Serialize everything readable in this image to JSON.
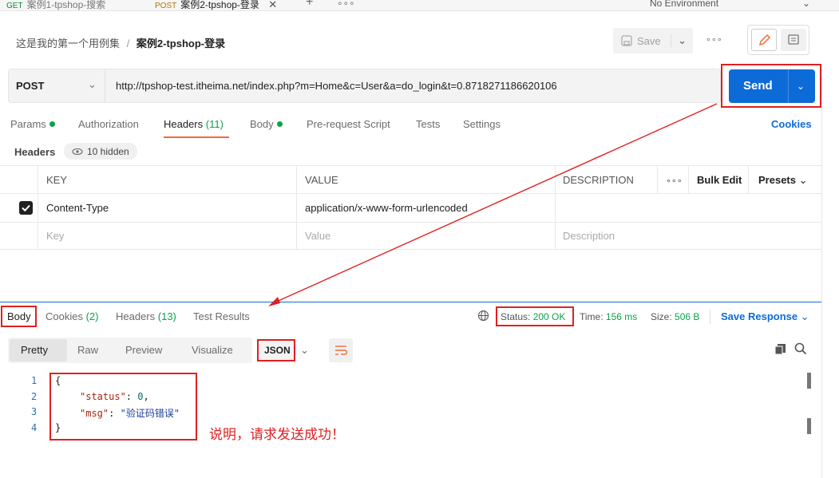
{
  "tabs": [
    {
      "method": "GET",
      "label": "案例1-tpshop-搜索"
    },
    {
      "method": "POST",
      "label": "案例2-tpshop-登录"
    }
  ],
  "tab_close": "✕",
  "tab_new": "+",
  "tab_more": "∘∘∘",
  "environment": {
    "label": "No Environment",
    "chevron": "⌄"
  },
  "breadcrumb": {
    "collection": "这是我的第一个用例集",
    "separator": "/",
    "request": "案例2-tpshop-登录"
  },
  "save": {
    "label": "Save",
    "chevron": "⌄",
    "more": "∘∘∘"
  },
  "request": {
    "method": "POST",
    "method_chevron": "⌄",
    "url": "http://tpshop-test.itheima.net/index.php?m=Home&c=User&a=do_login&t=0.8718271186620106",
    "send_label": "Send",
    "send_chevron": "⌄"
  },
  "request_tabs": [
    {
      "label": "Params",
      "dot": true
    },
    {
      "label": "Authorization"
    },
    {
      "label": "Headers",
      "count": "(11)",
      "active": true
    },
    {
      "label": "Body",
      "dot": true
    },
    {
      "label": "Pre-request Script"
    },
    {
      "label": "Tests"
    },
    {
      "label": "Settings"
    }
  ],
  "cookies_link": "Cookies",
  "headers_section": {
    "label": "Headers",
    "hidden_icon": "👁",
    "hidden_label": "10 hidden",
    "columns": {
      "key": "KEY",
      "value": "VALUE",
      "description": "DESCRIPTION"
    },
    "more": "∘∘∘",
    "bulk_edit": "Bulk Edit",
    "presets": "Presets",
    "presets_chevron": "⌄",
    "rows": [
      {
        "checked": true,
        "key": "Content-Type",
        "value": "application/x-www-form-urlencoded",
        "description": ""
      }
    ],
    "placeholder": {
      "key": "Key",
      "value": "Value",
      "description": "Description"
    }
  },
  "response_tabs": [
    {
      "label": "Body",
      "active": true
    },
    {
      "label": "Cookies",
      "count": "(2)"
    },
    {
      "label": "Headers",
      "count": "(13)"
    },
    {
      "label": "Test Results"
    }
  ],
  "response_meta": {
    "status_label": "Status:",
    "status_value": "200 OK",
    "time_label": "Time:",
    "time_value": "156 ms",
    "size_label": "Size:",
    "size_value": "506 B",
    "save_response": "Save Response",
    "save_response_chevron": "⌄"
  },
  "format_tabs": [
    "Pretty",
    "Raw",
    "Preview",
    "Visualize"
  ],
  "language": {
    "value": "JSON",
    "chevron": "⌄"
  },
  "code": {
    "lines": [
      "1",
      "2",
      "3",
      "4"
    ],
    "open": "{",
    "close": "}",
    "k1": "\"status\"",
    "v1": "0",
    "k2": "\"msg\"",
    "v2": "\"验证码错误\"",
    "colon": ":",
    "comma": ","
  },
  "annotation": "说明，请求发送成功！",
  "colors": {
    "accent": "#0d6bd8",
    "status_ok": "#0ba34a",
    "highlight": "#e02020",
    "tab_active": "#f26b3a"
  }
}
